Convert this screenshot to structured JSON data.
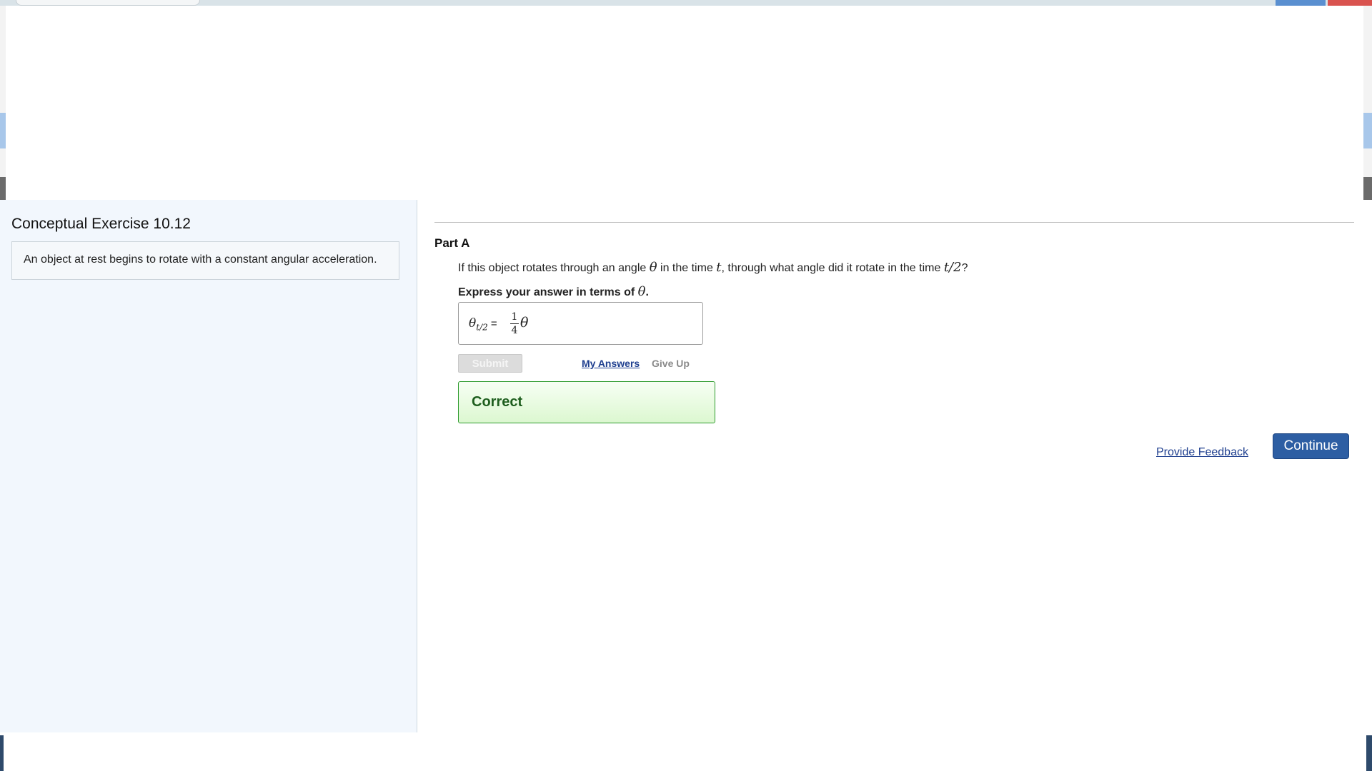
{
  "exercise": {
    "title": "Conceptual Exercise 10.12",
    "statement": "An object at rest begins to rotate with a constant angular acceleration."
  },
  "part": {
    "title": "Part A",
    "question_parts": [
      "If this object rotates through an angle ",
      "θ",
      " in the time ",
      "t",
      ", through what angle did it rotate in the time ",
      "t/2",
      "?"
    ],
    "instruction_prefix": "Express your answer in terms of ",
    "instruction_var": "θ",
    "instruction_suffix": "."
  },
  "answer": {
    "label_var": "θ",
    "label_sub": "t/2",
    "label_eq": " =",
    "numerator": "1",
    "denominator": "4",
    "value_var": "θ"
  },
  "actions": {
    "submit": "Submit",
    "my_answers": "My Answers",
    "give_up": "Give Up"
  },
  "feedback": {
    "status": "Correct"
  },
  "footer": {
    "provide_feedback": "Provide Feedback",
    "continue": "Continue"
  },
  "colors": {
    "link": "#1f3f8f",
    "continue_bg": "#2d5ea3",
    "correct_border": "#2e9b2e",
    "correct_text": "#1e5e1e",
    "left_panel_bg": "#f2f7fd"
  }
}
